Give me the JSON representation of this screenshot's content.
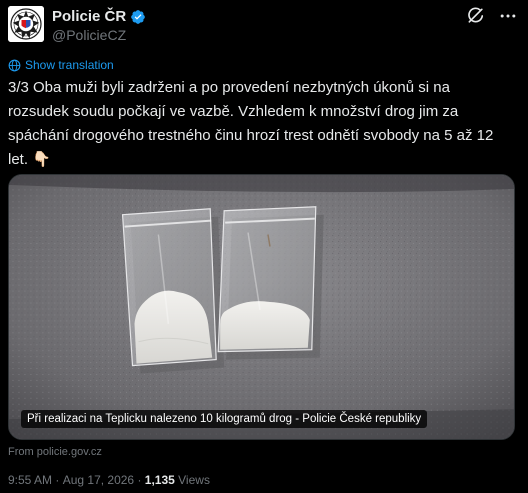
{
  "account": {
    "name": "Policie ČR",
    "handle": "@PolicieCZ",
    "verified": true,
    "avatar_icon": "police-star-logo-icon",
    "avatar_text": "POLICIE"
  },
  "actions": {
    "grok_icon": "grok-icon",
    "more_icon": "more-dots-icon"
  },
  "translate": {
    "label": "Show translation",
    "icon": "globe-icon"
  },
  "post": {
    "lines": [
      "3/3 Oba muži byli zadrženi a po provedení nezbytných úkonů si na",
      "rozsudek soudu počkají ve vazbě. Vzhledem k množství drog jim za",
      "spáchání drogového trestného činu hrozí trest odnětí svobody na 5 až 12",
      "let. 👇🏻"
    ]
  },
  "media": {
    "caption": "Při realizaci na Teplicku nalezeno 10 kilogramů drog - Policie České republiky"
  },
  "source": {
    "label": "From policie.gov.cz"
  },
  "meta": {
    "time": "9:55 AM",
    "separator": " · ",
    "date": "Aug 17, 2026",
    "views_count": "1,135",
    "views_label": " Views"
  },
  "colors": {
    "background": "#000000",
    "text": "#e7e9ea",
    "muted": "#71767b",
    "link": "#1d9bf0",
    "verified_badge": "#1d9bf0"
  }
}
